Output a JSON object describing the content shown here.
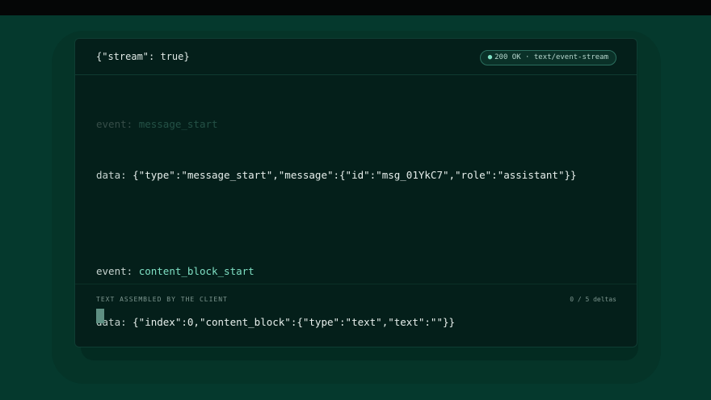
{
  "request": {
    "body": "{\"stream\": true}"
  },
  "status": {
    "text": "200 OK · text/event-stream",
    "dot": "●"
  },
  "events": [
    {
      "event_key": "event: ",
      "event_name": "message_start",
      "data_key": "data: ",
      "data_value": "{\"type\":\"message_start\",\"message\":{\"id\":\"msg_01YkC7\",\"role\":\"assistant\"}}"
    },
    {
      "event_key": "event: ",
      "event_name": "content_block_start",
      "data_key": "data: ",
      "data_value": "{\"index\":0,\"content_block\":{\"type\":\"text\",\"text\":\"\"}}"
    }
  ],
  "client": {
    "label": "TEXT ASSEMBLED BY THE CLIENT",
    "delta_count": "0 / 5 deltas",
    "assembled_text": ""
  },
  "colors": {
    "accent": "#7fe0c4",
    "background": "#05392d",
    "card": "#041f1a"
  }
}
